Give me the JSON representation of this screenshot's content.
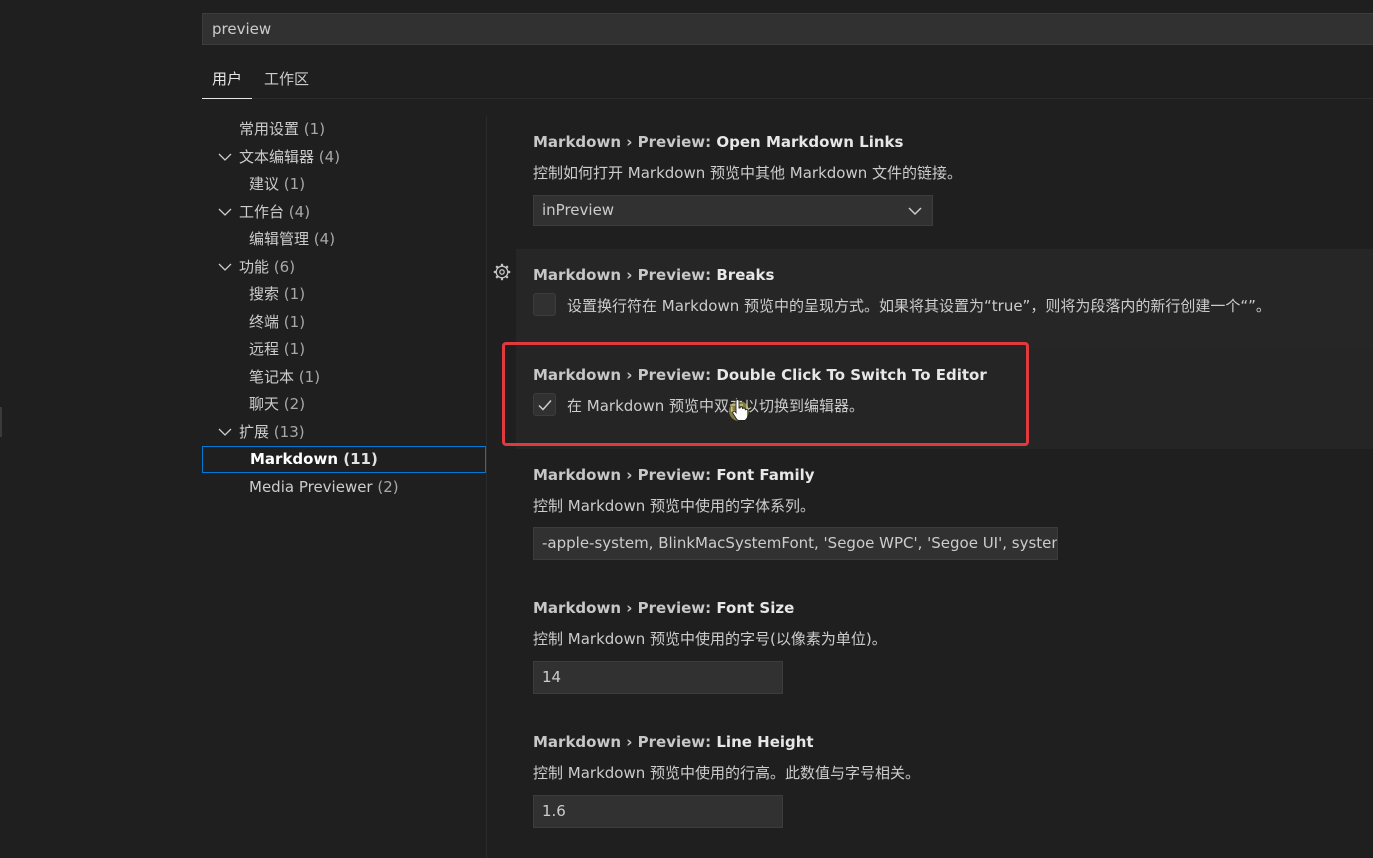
{
  "search": {
    "value": "preview"
  },
  "tabs": [
    {
      "label": "用户"
    },
    {
      "label": "工作区"
    }
  ],
  "toc": [
    {
      "label": "常用设置",
      "count": "(1)"
    },
    {
      "label": "文本编辑器",
      "count": "(4)"
    },
    {
      "label": "建议",
      "count": "(1)"
    },
    {
      "label": "工作台",
      "count": "(4)"
    },
    {
      "label": "编辑管理",
      "count": "(4)"
    },
    {
      "label": "功能",
      "count": "(6)"
    },
    {
      "label": "搜索",
      "count": "(1)"
    },
    {
      "label": "终端",
      "count": "(1)"
    },
    {
      "label": "远程",
      "count": "(1)"
    },
    {
      "label": "笔记本",
      "count": "(1)"
    },
    {
      "label": "聊天",
      "count": "(2)"
    },
    {
      "label": "扩展",
      "count": "(13)"
    },
    {
      "label": "Markdown",
      "count": "(11)"
    },
    {
      "label": "Media Previewer",
      "count": "(2)"
    }
  ],
  "settings": {
    "open_links": {
      "category": "Markdown › Preview: ",
      "key": "Open Markdown Links",
      "description": "控制如何打开 Markdown 预览中其他 Markdown 文件的链接。",
      "value": "inPreview"
    },
    "breaks": {
      "category": "Markdown › Preview: ",
      "key": "Breaks",
      "description": "设置换行符在 Markdown 预览中的呈现方式。如果将其设置为“true”，则将为段落内的新行创建一个“”。",
      "checked": false
    },
    "double_click": {
      "category": "Markdown › Preview: ",
      "key": "Double Click To Switch To Editor",
      "description": "在 Markdown 预览中双击以切换到编辑器。",
      "checked": true
    },
    "font_family": {
      "category": "Markdown › Preview: ",
      "key": "Font Family",
      "description": "控制 Markdown 预览中使用的字体系列。",
      "value": "-apple-system, BlinkMacSystemFont, 'Segoe WPC', 'Segoe UI', system..."
    },
    "font_size": {
      "category": "Markdown › Preview: ",
      "key": "Font Size",
      "description": "控制 Markdown 预览中使用的字号(以像素为单位)。",
      "value": "14"
    },
    "line_height": {
      "category": "Markdown › Preview: ",
      "key": "Line Height",
      "description": "控制 Markdown 预览中使用的行高。此数值与字号相关。",
      "value": "1.6"
    }
  },
  "colors": {
    "background": "#1f1f1f",
    "input_background": "#313131",
    "focus_border": "#0078d4",
    "highlight_box": "#e0393e",
    "cursor": "#f5e663"
  },
  "icons": [
    "chevron-down-icon",
    "gear-icon",
    "check-icon",
    "hand-cursor-icon"
  ]
}
